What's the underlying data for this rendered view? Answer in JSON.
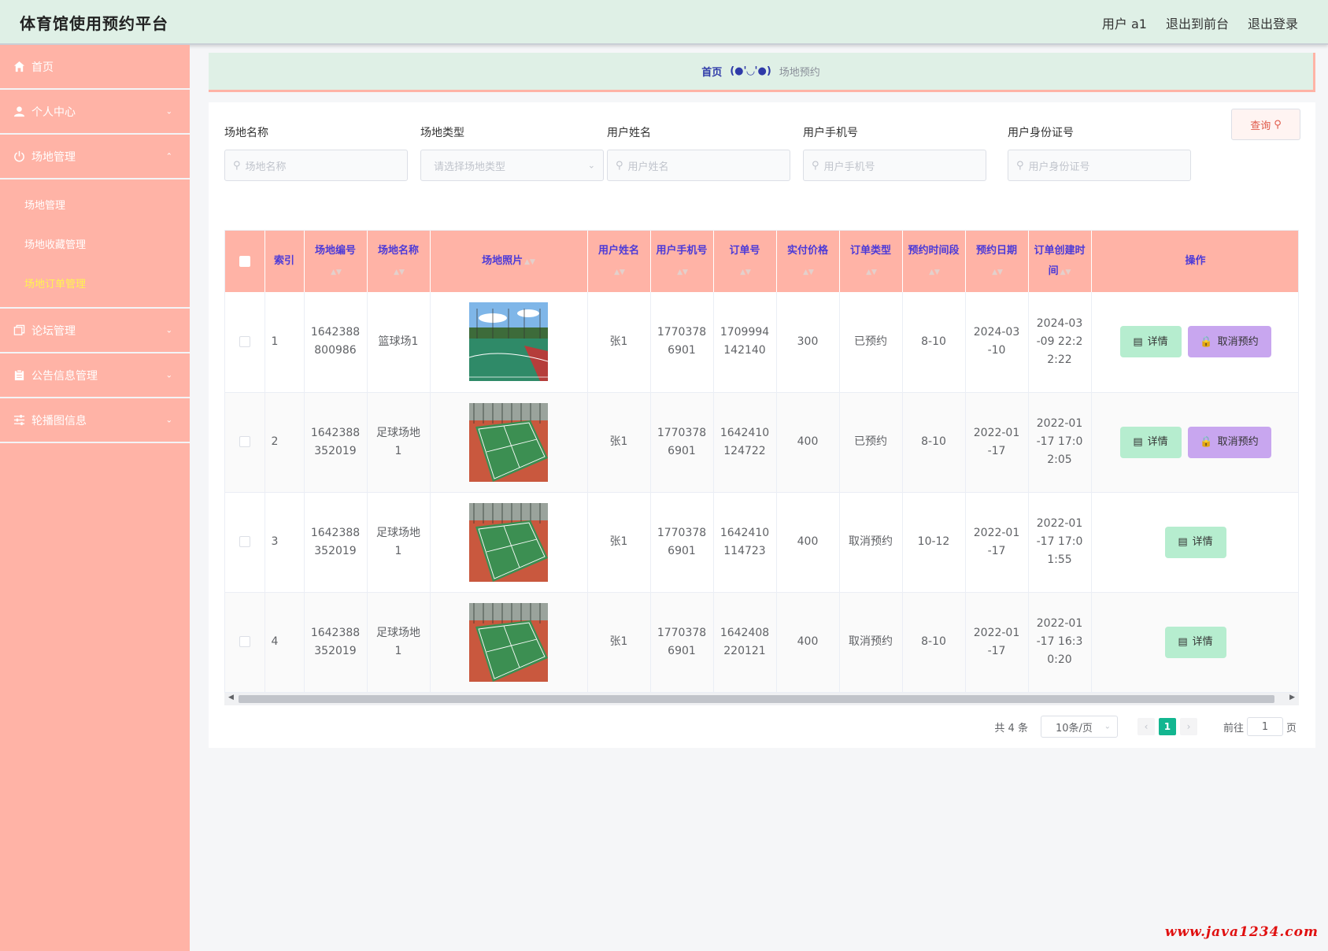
{
  "header": {
    "title": "体育馆使用预约平台",
    "user_label": "用户 a1",
    "to_front": "退出到前台",
    "logout": "退出登录"
  },
  "sidebar": {
    "home": "首页",
    "personal": "个人中心",
    "venue_mgmt": "场地管理",
    "sub": [
      "场地管理",
      "场地收藏管理",
      "场地订单管理"
    ],
    "active_sub": "场地订单管理",
    "forum": "论坛管理",
    "notice": "公告信息管理",
    "carousel": "轮播图信息"
  },
  "breadcrumb": {
    "home": "首页",
    "separator": "(●'◡'●)",
    "current": "场地预约"
  },
  "search": {
    "venue_name_label": "场地名称",
    "venue_name_placeholder": "场地名称",
    "venue_type_label": "场地类型",
    "venue_type_placeholder": "请选择场地类型",
    "user_name_label": "用户姓名",
    "user_name_placeholder": "用户姓名",
    "user_phone_label": "用户手机号",
    "user_phone_placeholder": "用户手机号",
    "user_id_label": "用户身份证号",
    "user_id_placeholder": "用户身份证号",
    "query_button": "查询"
  },
  "table": {
    "headers": {
      "index": "索引",
      "venue_no": "场地编号",
      "venue_name": "场地名称",
      "photo": "场地照片",
      "user_name": "用户姓名",
      "user_phone": "用户手机号",
      "order_no": "订单号",
      "price": "实付价格",
      "order_type": "订单类型",
      "time_slot": "预约时间段",
      "date": "预约日期",
      "created": "订单创建时间",
      "actions": "操作"
    },
    "detail_label": "详情",
    "cancel_label": "取消预约",
    "rows": [
      {
        "index": "1",
        "venue_no": "1642388800986",
        "venue_name": "篮球场1",
        "photo": "basketball-court",
        "user_name": "张1",
        "user_phone": "17703786901",
        "order_no": "1709994142140",
        "price": "300",
        "order_type": "已预约",
        "time_slot": "8-10",
        "date": "2024-03-10",
        "created": "2024-03-09 22:22:22"
      },
      {
        "index": "2",
        "venue_no": "1642388352019",
        "venue_name": "足球场地1",
        "photo": "tennis-court",
        "user_name": "张1",
        "user_phone": "17703786901",
        "order_no": "1642410124722",
        "price": "400",
        "order_type": "已预约",
        "time_slot": "8-10",
        "date": "2022-01-17",
        "created": "2022-01-17 17:02:05"
      },
      {
        "index": "3",
        "venue_no": "1642388352019",
        "venue_name": "足球场地1",
        "photo": "tennis-court",
        "user_name": "张1",
        "user_phone": "17703786901",
        "order_no": "1642410114723",
        "price": "400",
        "order_type": "取消预约",
        "time_slot": "10-12",
        "date": "2022-01-17",
        "created": "2022-01-17 17:01:55"
      },
      {
        "index": "4",
        "venue_no": "1642388352019",
        "venue_name": "足球场地1",
        "photo": "tennis-court",
        "user_name": "张1",
        "user_phone": "17703786901",
        "order_no": "1642408220121",
        "price": "400",
        "order_type": "取消预约",
        "time_slot": "8-10",
        "date": "2022-01-17",
        "created": "2022-01-17 16:30:20"
      }
    ]
  },
  "pagination": {
    "total": "共 4 条",
    "page_size": "10条/页",
    "current_page": "1",
    "goto_label": "前往",
    "goto_value": "1",
    "page_unit": "页"
  },
  "watermark": "www.java1234.com",
  "colors": {
    "sidebar": "#ffb3a6",
    "header": "#dff0e6",
    "table_header": "#ffb3a6",
    "header_text": "#4b3ad8",
    "detail_button": "#b6edcf",
    "cancel_button": "#c8a6ef",
    "active_page": "#13b690",
    "active_menu_text": "#fff44f"
  }
}
